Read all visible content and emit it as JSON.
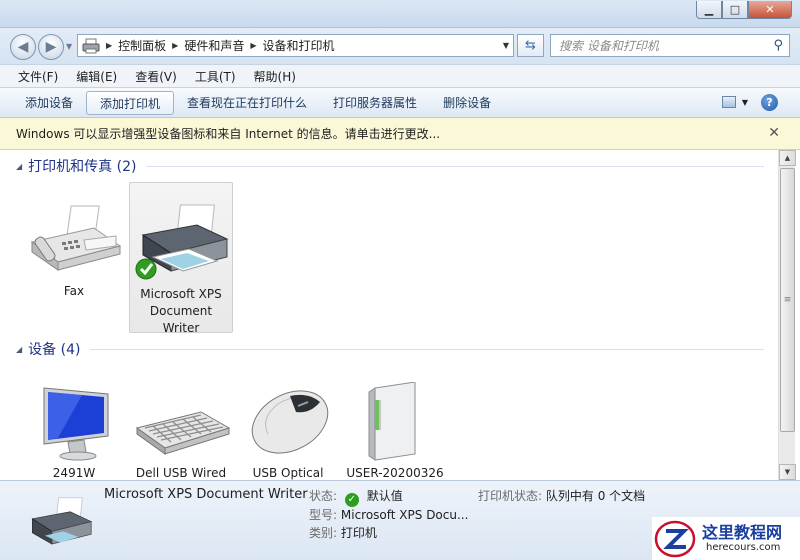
{
  "window": {
    "minimize": "▁",
    "maximize": "□",
    "close": "✕"
  },
  "address": {
    "crumbs": [
      "控制面板",
      "硬件和声音",
      "设备和打印机"
    ]
  },
  "search": {
    "placeholder": "搜索 设备和打印机"
  },
  "menu": [
    "文件(F)",
    "编辑(E)",
    "查看(V)",
    "工具(T)",
    "帮助(H)"
  ],
  "commands": [
    "添加设备",
    "添加打印机",
    "查看现在正在打印什么",
    "打印服务器属性",
    "删除设备"
  ],
  "info_bar": {
    "text": "Windows 可以显示增强型设备图标和来自 Internet 的信息。请单击进行更改..."
  },
  "groups": [
    {
      "title": "打印机和传真 (2)",
      "items": [
        {
          "label": "Fax",
          "icon": "fax-icon"
        },
        {
          "label": "Microsoft XPS Document Writer",
          "icon": "printer-icon",
          "selected": true,
          "default": true
        }
      ]
    },
    {
      "title": "设备 (4)",
      "items": [
        {
          "label": "2491W",
          "icon": "monitor-icon"
        },
        {
          "label": "Dell USB Wired",
          "icon": "keyboard-icon"
        },
        {
          "label": "USB Optical",
          "icon": "mouse-icon"
        },
        {
          "label": "USER-20200326",
          "icon": "computer-tower-icon"
        }
      ]
    }
  ],
  "details": {
    "name": "Microsoft XPS Document Writer",
    "status_label": "状态:",
    "status_value": "默认值",
    "model_label": "型号:",
    "model_value": "Microsoft XPS Docu...",
    "category_label": "类别:",
    "category_value": "打印机",
    "printer_status_label": "打印机状态:",
    "printer_status_value": "队列中有 0 个文档"
  },
  "watermark": {
    "title": "这里教程网",
    "url": "herecours.com"
  },
  "colors": {
    "group_title": "#1e3287",
    "info_bar_bg": "#fbf8d8",
    "check_green": "#2f9e1f",
    "watermark_red": "#c8102e"
  }
}
